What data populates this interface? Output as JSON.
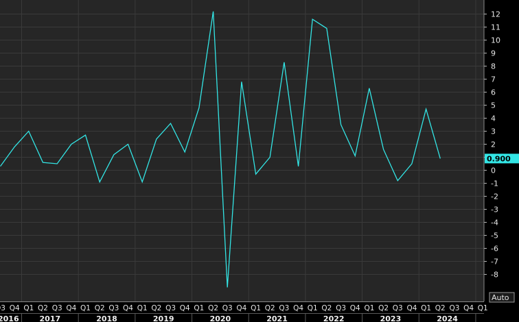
{
  "chart_data": {
    "type": "line",
    "title": "",
    "xlabel": "",
    "ylabel": "",
    "ylim": [
      -9,
      12.5
    ],
    "y_ticks": [
      -8,
      -7,
      -6,
      -5,
      -4,
      -3,
      -2,
      -1,
      0,
      1,
      2,
      3,
      4,
      5,
      6,
      7,
      8,
      9,
      10,
      11,
      12
    ],
    "grid": true,
    "series": [
      {
        "color": "#33e6e6",
        "x": [
          "2016 Q3",
          "2016 Q4",
          "2017 Q1",
          "2017 Q2",
          "2017 Q3",
          "2017 Q4",
          "2018 Q1",
          "2018 Q2",
          "2018 Q3",
          "2018 Q4",
          "2019 Q1",
          "2019 Q2",
          "2019 Q3",
          "2019 Q4",
          "2020 Q1",
          "2020 Q2",
          "2020 Q3",
          "2020 Q4",
          "2021 Q1",
          "2021 Q2",
          "2021 Q3",
          "2021 Q4",
          "2022 Q1",
          "2022 Q2",
          "2022 Q3",
          "2022 Q4",
          "2023 Q1",
          "2023 Q2",
          "2023 Q3",
          "2023 Q4",
          "2024 Q1",
          "2024 Q2"
        ],
        "values": [
          0.3,
          1.8,
          3.0,
          0.6,
          0.5,
          2.0,
          2.7,
          -0.9,
          1.2,
          2.0,
          -0.9,
          2.4,
          3.6,
          1.4,
          4.8,
          12.2,
          -9.0,
          6.8,
          -0.3,
          1.0,
          8.3,
          0.3,
          11.6,
          10.9,
          3.5,
          1.1,
          6.3,
          1.6,
          -0.8,
          0.5,
          4.7,
          0.9
        ]
      }
    ],
    "x_quarter_labels": [
      "Q3",
      "Q4",
      "Q1",
      "Q2",
      "Q3",
      "Q4",
      "Q1",
      "Q2",
      "Q3",
      "Q4",
      "Q1",
      "Q2",
      "Q3",
      "Q4",
      "Q1",
      "Q2",
      "Q3",
      "Q4",
      "Q1",
      "Q2",
      "Q3",
      "Q4",
      "Q1",
      "Q2",
      "Q3",
      "Q4",
      "Q1",
      "Q2",
      "Q3",
      "Q4",
      "Q1",
      "Q2",
      "Q3",
      "Q4",
      "Q1"
    ],
    "x_year_labels": [
      "2016",
      "2017",
      "2018",
      "2019",
      "2020",
      "2021",
      "2022",
      "2023",
      "2024"
    ],
    "last_value_label": "0.900",
    "auto_button_label": "Auto"
  },
  "colors": {
    "background": "#000000",
    "plot_background": "#262626",
    "grid": "#3a3a3a",
    "line": "#33e6e6",
    "last_value_badge": "#33e6e6"
  }
}
